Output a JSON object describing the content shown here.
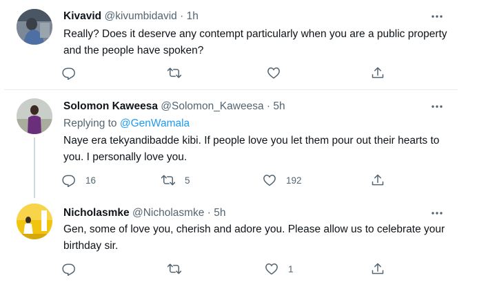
{
  "tweets": [
    {
      "name": "Kivavid",
      "handle": "@kivumbidavid",
      "dot": "·",
      "time": "1h",
      "replying_prefix": "",
      "replying_to": "",
      "text": "Really? Does it deserve any contempt particularly when you are a public property and the people have spoken?",
      "replies": "",
      "retweets": "",
      "likes": ""
    },
    {
      "name": "Solomon Kaweesa",
      "handle": "@Solomon_Kaweesa",
      "dot": "·",
      "time": "5h",
      "replying_prefix": "Replying to ",
      "replying_to": "@GenWamala",
      "text": "Naye era tekyandibadde kibi. If people love you let them pour out their hearts to you. I personally love you.",
      "replies": "16",
      "retweets": "5",
      "likes": "192"
    },
    {
      "name": "Nicholasmke",
      "handle": "@Nicholasmke",
      "dot": "·",
      "time": "5h",
      "replying_prefix": "",
      "replying_to": "",
      "text": "Gen, some of  love you, cherish and adore you.  Please allow us to celebrate your birthday sir.",
      "replies": "",
      "retweets": "",
      "likes": "1"
    }
  ],
  "icons": {
    "reply": "reply-icon",
    "retweet": "retweet-icon",
    "like": "heart-icon",
    "share": "share-icon",
    "more": "more-icon"
  },
  "colors": {
    "text": "#0f1419",
    "secondary": "#536471",
    "link": "#1d9bf0",
    "divider": "#e9ecef",
    "thread_line": "#cfd9de"
  }
}
